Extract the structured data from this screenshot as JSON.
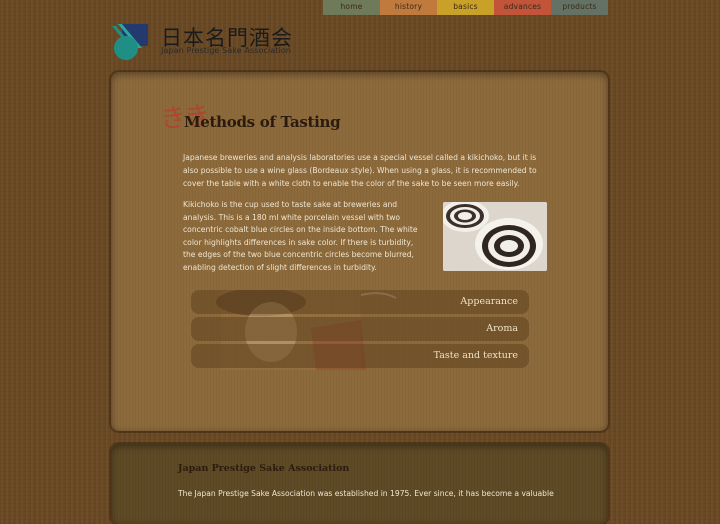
{
  "nav": {
    "tabs": [
      {
        "label": "home"
      },
      {
        "label": "history"
      },
      {
        "label": "basics"
      },
      {
        "label": "advances"
      },
      {
        "label": "products"
      }
    ]
  },
  "logo": {
    "jp": "日本名門酒会",
    "en": "Japan Prestige Sake Association"
  },
  "main": {
    "decorative_kanji": "きき",
    "title": "Methods of Tasting",
    "paragraph1": "Japanese breweries and analysis laboratories use a special vessel called a kikichoko, but it is also possible to use a wine glass (Bordeaux style). When using a glass, it is recommended to cover the table with a white cloth to enable the color of the sake to be seen more easily.",
    "paragraph2": "Kikichoko is the cup used to taste sake at breweries and analysis. This is a 180 ml white porcelain vessel with two concentric cobalt blue circles on the inside bottom. The white color highlights differences in sake color. If there is turbidity, the edges of the two blue concentric circles become blurred, enabling detection of slight differences in turbidity.",
    "accordion": [
      {
        "label": "Appearance"
      },
      {
        "label": "Aroma"
      },
      {
        "label": "Taste and texture"
      }
    ]
  },
  "footer_panel": {
    "title": "Japan Prestige Sake Association",
    "text": "The Japan Prestige Sake Association was established in 1975. Ever since, it has become a valuable"
  },
  "colors": {
    "background": "#6b4a25",
    "panel": "#8c6a3c",
    "tab_home": "#6f7a5a",
    "tab_history": "#c07a3e",
    "tab_basics": "#c9a028",
    "tab_advances": "#c2543a",
    "tab_products": "#637264"
  }
}
